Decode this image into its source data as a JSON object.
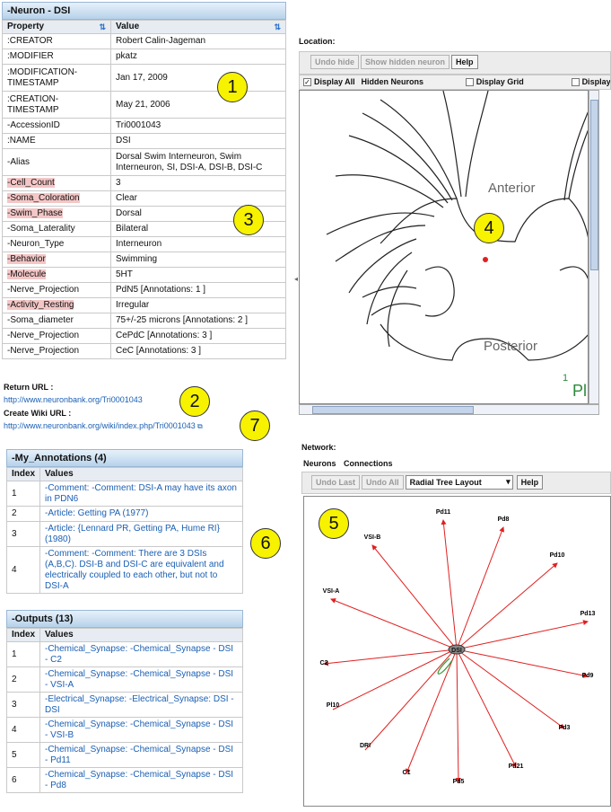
{
  "neuron": {
    "title": "-Neuron - DSI",
    "col_property": "Property",
    "col_value": "Value",
    "rows": [
      {
        "p": ":CREATOR",
        "v": "Robert Calin-Jageman",
        "h": false
      },
      {
        "p": ":MODIFIER",
        "v": "pkatz",
        "h": false
      },
      {
        "p": ":MODIFICATION-TIMESTAMP",
        "v": "Jan 17, 2009",
        "h": false
      },
      {
        "p": ":CREATION-TIMESTAMP",
        "v": "May 21, 2006",
        "h": false
      },
      {
        "p": "-AccessionID",
        "v": "Tri0001043",
        "h": false
      },
      {
        "p": ":NAME",
        "v": "DSI",
        "h": false
      },
      {
        "p": "-Alias",
        "v": "Dorsal Swim Interneuron, Swim Interneuron, SI, DSI-A, DSI-B, DSI-C",
        "h": false
      },
      {
        "p": "-Cell_Count",
        "v": "3",
        "h": true
      },
      {
        "p": "-Soma_Coloration",
        "v": "Clear",
        "h": true
      },
      {
        "p": "-Swim_Phase",
        "v": "Dorsal",
        "h": true
      },
      {
        "p": "-Soma_Laterality",
        "v": "Bilateral",
        "h": false
      },
      {
        "p": "-Neuron_Type",
        "v": "Interneuron",
        "h": false
      },
      {
        "p": "-Behavior",
        "v": "Swimming",
        "h": true
      },
      {
        "p": "-Molecule",
        "v": "5HT",
        "h": true
      },
      {
        "p": "-Nerve_Projection",
        "v": "PdN5 [Annotations: 1 ]",
        "h": false
      },
      {
        "p": "-Activity_Resting",
        "v": "Irregular",
        "h": true
      },
      {
        "p": "-Soma_diameter",
        "v": "75+/-25 microns [Annotations: 2 ]",
        "h": false
      },
      {
        "p": "-Nerve_Projection",
        "v": "CePdC [Annotations: 3 ]",
        "h": false
      },
      {
        "p": "-Nerve_Projection",
        "v": "CeC [Annotations: 3 ]",
        "h": false
      }
    ]
  },
  "return_url": {
    "label": "Return URL :",
    "url": "http://www.neuronbank.org/Tri0001043"
  },
  "wiki_url": {
    "label": "Create Wiki URL :",
    "url": "http://www.neuronbank.org/wiki/index.php/Tri0001043"
  },
  "annotations": {
    "title": "-My_Annotations (4)",
    "col_index": "Index",
    "col_values": "Values",
    "rows": [
      {
        "i": "1",
        "v": "-Comment: -Comment: DSI-A may have its axon in PDN6"
      },
      {
        "i": "2",
        "v": "-Article: Getting PA (1977)"
      },
      {
        "i": "3",
        "v": "-Article: {Lennard PR, Getting PA, Hume RI} (1980)"
      },
      {
        "i": "4",
        "v": "-Comment: -Comment: There are 3 DSIs (A,B,C). DSI-B and DSI-C are equivalent and electrically coupled to each other, but not to DSI-A"
      }
    ]
  },
  "outputs": {
    "title": "-Outputs (13)",
    "col_index": "Index",
    "col_values": "Values",
    "rows": [
      {
        "i": "1",
        "v": "-Chemical_Synapse: -Chemical_Synapse - DSI - C2"
      },
      {
        "i": "2",
        "v": "-Chemical_Synapse: -Chemical_Synapse - DSI - VSI-A"
      },
      {
        "i": "3",
        "v": "-Electrical_Synapse: -Electrical_Synapse: DSI - DSI"
      },
      {
        "i": "4",
        "v": "-Chemical_Synapse: -Chemical_Synapse - DSI - VSI-B"
      },
      {
        "i": "5",
        "v": "-Chemical_Synapse: -Chemical_Synapse - DSI - Pd11"
      },
      {
        "i": "6",
        "v": "-Chemical_Synapse: -Chemical_Synapse - DSI - Pd8"
      }
    ]
  },
  "location": {
    "label": "Location:",
    "undo_hide": "Undo hide",
    "show_hidden": "Show hidden neuron",
    "help": "Help",
    "display_all": "Display All",
    "hidden_neurons": "Hidden Neurons",
    "display_grid": "Display Grid",
    "display_cut": "Display",
    "anterior": "Anterior",
    "posterior": "Posterior",
    "corner_num": "1",
    "corner_txt": "Pl"
  },
  "network": {
    "label": "Network:",
    "tab_neurons": "Neurons",
    "tab_connections": "Connections",
    "undo_last": "Undo Last",
    "undo_all": "Undo All",
    "layout": "Radial Tree Layout",
    "help": "Help",
    "center": "DSI",
    "nodes": [
      "Pd11",
      "Pd8",
      "VSI-B",
      "Pd10",
      "VSI-A",
      "Pd13",
      "C2",
      "Pd9",
      "Pl10",
      "Pd3",
      "DRI",
      "Pd21",
      "C1",
      "Pd5"
    ]
  },
  "callouts": [
    "1",
    "2",
    "3",
    "4",
    "5",
    "6",
    "7"
  ],
  "colors": {
    "header": "#b7d2ea",
    "link": "#1a5fb4",
    "highlight": "#f4c6c6",
    "callout": "#f7f200",
    "edge": "#e02020"
  }
}
